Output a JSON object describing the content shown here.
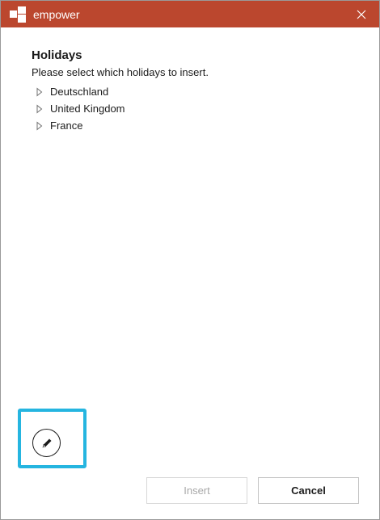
{
  "window": {
    "title": "empower",
    "accent_color": "#bb472e",
    "close_icon": "close-icon"
  },
  "dialog": {
    "heading": "Holidays",
    "instruction": "Please select which holidays to insert.",
    "countries": [
      {
        "label": "Deutschland",
        "expanded": false
      },
      {
        "label": "United Kingdom",
        "expanded": false
      },
      {
        "label": "France",
        "expanded": false
      }
    ]
  },
  "edit": {
    "icon": "pencil-icon",
    "highlight_color": "#25b5e0"
  },
  "buttons": {
    "insert_label": "Insert",
    "insert_enabled": false,
    "cancel_label": "Cancel"
  }
}
